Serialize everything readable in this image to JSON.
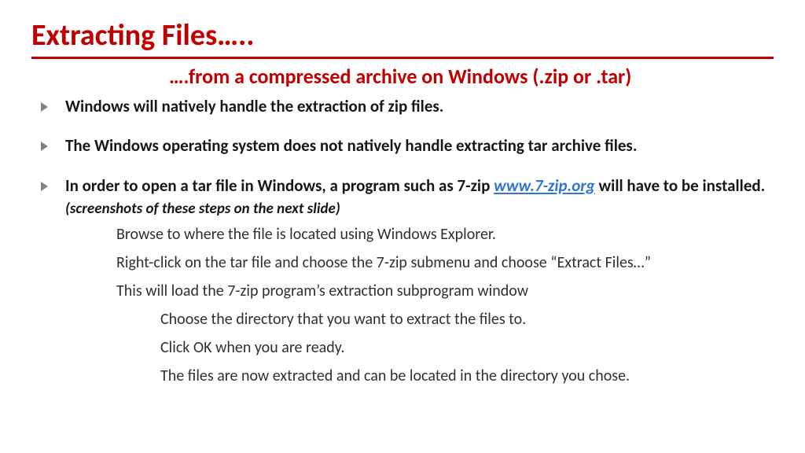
{
  "title": "Extracting Files…..",
  "subtitle": "….from a compressed archive on Windows (.zip or .tar)",
  "bullets": {
    "b1": "Windows will natively handle the extraction of zip files.",
    "b2": "The Windows operating system does not natively handle extracting tar archive files.",
    "b3_pre": "In order to open a tar file in Windows, a program such as 7-zip ",
    "b3_link": "www.7-zip.org",
    "b3_link_href": "http://www.7-zip.org",
    "b3_post": " will have to be installed. ",
    "b3_note": "(screenshots of these steps on the next slide)"
  },
  "sub": {
    "s1": "Browse to where the file is located using Windows Explorer.",
    "s2": "Right-click on the tar file and choose the 7-zip submenu and choose “Extract Files…”",
    "s3": "This will load the 7-zip program’s extraction subprogram window"
  },
  "subsub": {
    "ss1": "Choose the directory that you want to extract the files to.",
    "ss2": "Click OK when you are ready.",
    "ss3": "The files are now extracted and can be located in the directory you chose."
  }
}
